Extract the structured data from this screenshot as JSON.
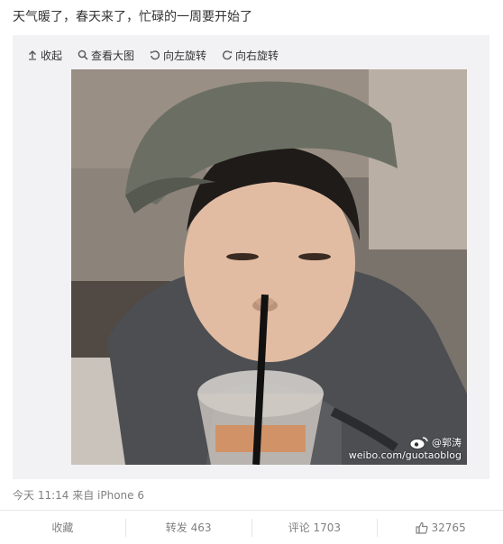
{
  "post": {
    "text": "天气暖了，春天来了，忙碌的一周要开始了"
  },
  "toolbar": {
    "collapse": "收起",
    "view_large": "查看大图",
    "rotate_left": "向左旋转",
    "rotate_right": "向右旋转"
  },
  "watermark": {
    "handle": "@郭涛",
    "url": "weibo.com/guotaoblog"
  },
  "meta": {
    "time_source": "今天 11:14 来自 iPhone 6"
  },
  "actions": {
    "favorite": "收藏",
    "repost": "转发 463",
    "comment": "评论 1703",
    "like_count": "32765"
  },
  "colors": {
    "text": "#333333",
    "muted": "#808080",
    "media_bg": "#f2f2f5",
    "divider": "#e6e6e6"
  }
}
